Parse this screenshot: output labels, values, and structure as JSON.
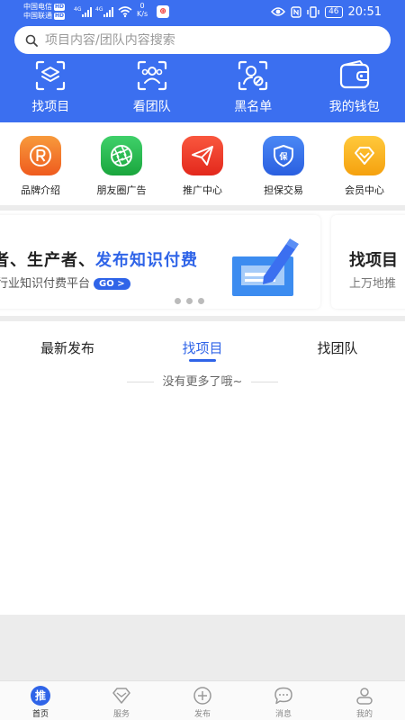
{
  "status_bar": {
    "carrier_1": "中国电信",
    "carrier_2": "中国联通",
    "hd_badge": "HD",
    "network_1": "4G",
    "network_2": "4G",
    "speed_value": "0",
    "speed_unit": "K/s",
    "battery": "46",
    "time": "20:51"
  },
  "search": {
    "placeholder": "项目内容/团队内容搜索"
  },
  "top_nav": [
    {
      "label": "找项目",
      "icon": "layers-scan-icon"
    },
    {
      "label": "看团队",
      "icon": "team-scan-icon"
    },
    {
      "label": "黑名单",
      "icon": "user-block-icon"
    },
    {
      "label": "我的钱包",
      "icon": "wallet-icon"
    }
  ],
  "services": [
    {
      "label": "品牌介绍",
      "icon": "registered-icon",
      "color": "#f3732b"
    },
    {
      "label": "朋友圈广告",
      "icon": "aperture-icon",
      "color": "#28b94e"
    },
    {
      "label": "推广中心",
      "icon": "paper-plane-icon",
      "color": "#ef3b2c"
    },
    {
      "label": "担保交易",
      "icon": "shield-icon",
      "color": "#2f6fe8"
    },
    {
      "label": "会员中心",
      "icon": "diamond-icon",
      "color": "#f7b21b"
    }
  ],
  "banner": {
    "slide_a": {
      "headline_prefix": "者、生产者、",
      "headline_highlight": "发布知识付费",
      "subtitle": "行业知识付费平台",
      "go_label": "GO >"
    },
    "slide_b": {
      "headline": "找项目",
      "subtitle": "上万地推"
    }
  },
  "tabs": [
    {
      "label": "最新发布",
      "active": false
    },
    {
      "label": "找项目",
      "active": true
    },
    {
      "label": "找团队",
      "active": false
    }
  ],
  "empty_text": "没有更多了哦~",
  "bottom_nav": [
    {
      "label": "首页",
      "icon": "home-icon",
      "badge": "推",
      "active": true
    },
    {
      "label": "服务",
      "icon": "diamond-outline-icon",
      "active": false
    },
    {
      "label": "发布",
      "icon": "plus-circle-icon",
      "active": false
    },
    {
      "label": "消息",
      "icon": "chat-bubble-icon",
      "active": false
    },
    {
      "label": "我的",
      "icon": "user-icon",
      "active": false
    }
  ],
  "colors": {
    "brand_blue": "#3b6ff0",
    "accent_blue": "#2f64e8"
  }
}
